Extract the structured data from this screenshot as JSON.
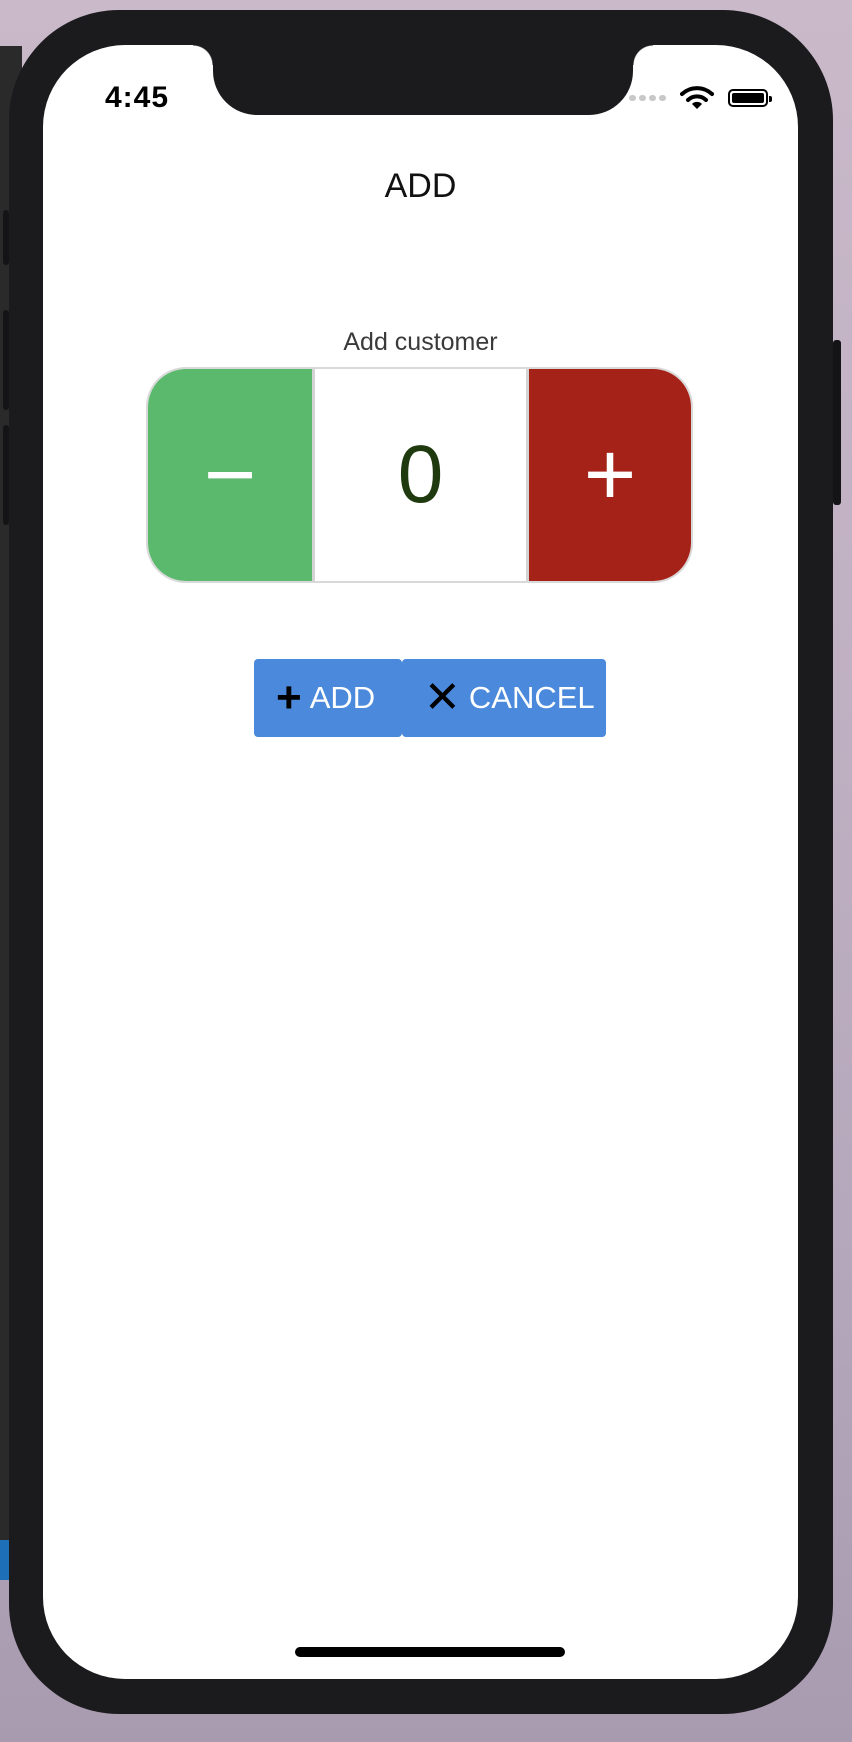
{
  "status_bar": {
    "time": "4:45"
  },
  "header": {
    "title": "ADD"
  },
  "form": {
    "label": "Add customer",
    "stepper": {
      "decrement_symbol": "−",
      "value": "0",
      "increment_symbol": "+"
    }
  },
  "actions": {
    "add_icon": "+",
    "add_label": "ADD",
    "cancel_icon": "✕",
    "cancel_label": "CANCEL"
  },
  "colors": {
    "decrement": "#5bb96d",
    "increment": "#a42218",
    "button": "#4a89dc",
    "value_text": "#1f3a0f"
  },
  "icons": [
    "wifi-icon",
    "battery-icon",
    "signal-icon",
    "plus-icon",
    "close-icon"
  ]
}
